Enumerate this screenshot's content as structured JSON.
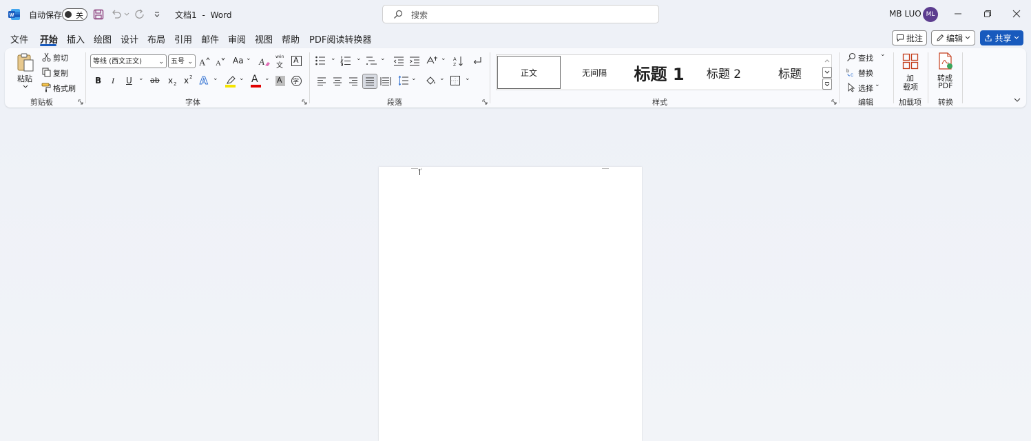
{
  "titlebar": {
    "autosave_label": "自动保存",
    "autosave_state": "关",
    "doc_name": "文档1",
    "separator": "-",
    "app_name": "Word",
    "search_placeholder": "搜索",
    "user_name": "MB LUO",
    "avatar_initials": "ML"
  },
  "menu": {
    "tabs": [
      "文件",
      "开始",
      "插入",
      "绘图",
      "设计",
      "布局",
      "引用",
      "邮件",
      "审阅",
      "视图",
      "帮助",
      "PDF阅读转换器"
    ],
    "active_tab": "开始",
    "comments_label": "批注",
    "editing_label": "编辑",
    "share_label": "共享"
  },
  "clipboard": {
    "paste": "粘贴",
    "cut": "剪切",
    "copy": "复制",
    "format_painter": "格式刷",
    "group": "剪贴板"
  },
  "font": {
    "font_name": "等线 (西文正文)",
    "font_size": "五号",
    "change_case": "Aa",
    "phonetic_top": "wén",
    "phonetic_bottom": "文",
    "bold": "B",
    "italic": "I",
    "underline": "U",
    "strike": "ab",
    "subscript": "x",
    "superscript": "x",
    "text_effects": "A",
    "font_color": "A",
    "char_shading": "A",
    "char_border": "A",
    "enclose": "字",
    "group": "字体"
  },
  "paragraph": {
    "group": "段落"
  },
  "styles": {
    "items": [
      "正文",
      "无间隔",
      "标题 1",
      "标题 2",
      "标题"
    ],
    "group": "样式"
  },
  "editing": {
    "find": "查找",
    "replace": "替换",
    "select": "选择",
    "group": "编辑"
  },
  "addins": {
    "button_line1": "加",
    "button_line2": "载项",
    "group": "加载项"
  },
  "convert": {
    "button_line1": "转成",
    "button_line2": "PDF",
    "group": "转换"
  },
  "colors": {
    "accent": "#185abd",
    "highlight": "#ffff00",
    "font_color": "#e00000",
    "word_blue": "#1b5fc1",
    "addin_red": "#c43e1c"
  }
}
